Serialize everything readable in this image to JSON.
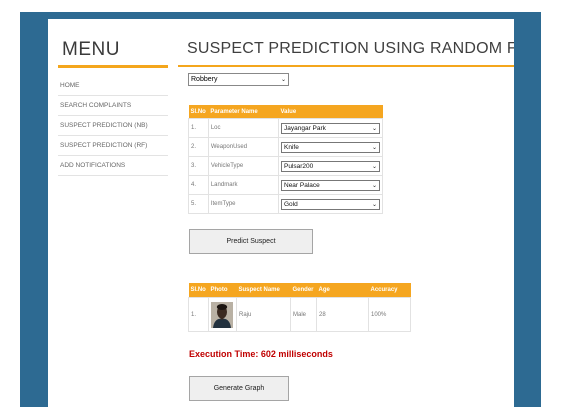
{
  "sidebar": {
    "title": "MENU",
    "items": [
      {
        "label": "HOME"
      },
      {
        "label": "SEARCH COMPLAINTS"
      },
      {
        "label": "SUSPECT PREDICTION (NB)"
      },
      {
        "label": "SUSPECT PREDICTION (RF)"
      },
      {
        "label": "ADD NOTIFICATIONS"
      }
    ]
  },
  "main": {
    "title": "SUSPECT PREDICTION USING RANDOM FOREST!",
    "crime_type": "Robbery"
  },
  "parameters": {
    "headers": {
      "slno": "Sl.No",
      "name": "Parameter Name",
      "value": "Value"
    },
    "rows": [
      {
        "slno": "1.",
        "name": "Loc",
        "value": "Jayangar Park"
      },
      {
        "slno": "2.",
        "name": "WeaponUsed",
        "value": "Knife"
      },
      {
        "slno": "3.",
        "name": "VehicleType",
        "value": "Pulsar200"
      },
      {
        "slno": "4.",
        "name": "Landmark",
        "value": "Near Palace"
      },
      {
        "slno": "5.",
        "name": "ItemType",
        "value": "Gold"
      }
    ]
  },
  "predict_button": "Predict Suspect",
  "results": {
    "headers": {
      "slno": "Sl.No",
      "photo": "Photo",
      "name": "Suspect Name",
      "gender": "Gender",
      "age": "Age",
      "accuracy": "Accuracy"
    },
    "rows": [
      {
        "slno": "1.",
        "name": "Raju",
        "gender": "Male",
        "age": "28",
        "accuracy": "100%"
      }
    ]
  },
  "execution_time": "Execution Time: 602 milliseconds",
  "graph_button": "Generate Graph",
  "colors": {
    "frame": "#2d6a92",
    "accent": "#f5a620",
    "exec_text": "#c00000"
  }
}
